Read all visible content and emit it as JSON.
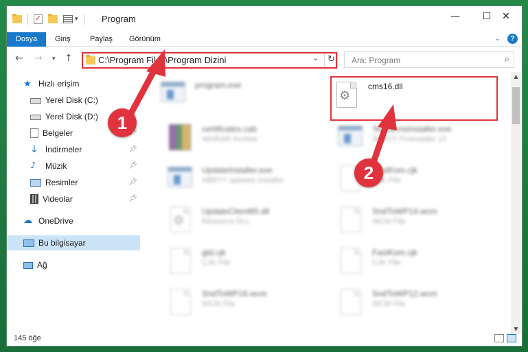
{
  "window": {
    "title": "Program",
    "controls": {
      "minimize": "—",
      "maximize": "☐",
      "close": "✕"
    }
  },
  "ribbon": {
    "tabs": [
      "Dosya",
      "Giriş",
      "Paylaş",
      "Görünüm"
    ],
    "active_tab": "Dosya"
  },
  "navigation": {
    "address": "C:\\Program Files\\Program Dizini",
    "search_placeholder": "Ara: Program"
  },
  "sidebar": {
    "items": [
      {
        "label": "Hızlı erişim",
        "icon": "star-icon"
      },
      {
        "label": "Yerel Disk (C:)",
        "icon": "drive-icon"
      },
      {
        "label": "Yerel Disk (D:)",
        "icon": "drive-icon"
      },
      {
        "label": "Belgeler",
        "icon": "documents-icon",
        "pinned": true
      },
      {
        "label": "İndirmeler",
        "icon": "download-icon",
        "pinned": true
      },
      {
        "label": "Müzik",
        "icon": "music-icon",
        "pinned": true
      },
      {
        "label": "Resimler",
        "icon": "pictures-icon",
        "pinned": true
      },
      {
        "label": "Videolar",
        "icon": "videos-icon",
        "pinned": true
      },
      {
        "label": "OneDrive",
        "icon": "cloud-icon"
      },
      {
        "label": "Bu bilgisayar",
        "icon": "computer-icon",
        "selected": true
      },
      {
        "label": "Ağ",
        "icon": "network-icon"
      }
    ]
  },
  "files": [
    {
      "name": "program.exe",
      "type": "",
      "kind": "exe"
    },
    {
      "name": "cms16.dll",
      "type": "",
      "kind": "dll",
      "highlighted": true
    },
    {
      "name": "certificates.cab",
      "type": "WinRAR Archive",
      "kind": "rar"
    },
    {
      "name": "TextItemsInstaller.exe",
      "type": "ABBYY Finereader 10",
      "kind": "exe"
    },
    {
      "name": "UpdateInstaller.exe",
      "type": "ABBYY updates installer",
      "kind": "exe"
    },
    {
      "name": "FastKom.cjk",
      "type": "CJK File",
      "kind": "doc"
    },
    {
      "name": "UpdateClient65.dll",
      "type": "Resource DLL",
      "kind": "dll"
    },
    {
      "name": "SndToWP14.wcm",
      "type": "WCM File",
      "kind": "doc"
    },
    {
      "name": "gtd.cjk",
      "type": "CJK File",
      "kind": "doc"
    },
    {
      "name": "FastKom.cjk",
      "type": "CJK File",
      "kind": "doc"
    },
    {
      "name": "SndToWP16.wcm",
      "type": "WCM File",
      "kind": "doc"
    },
    {
      "name": "SndToWP12.wcm",
      "type": "WCM File",
      "kind": "doc"
    }
  ],
  "callouts": [
    "1",
    "2"
  ],
  "status": {
    "count": "145 öğe"
  },
  "colors": {
    "accent": "#1979ca",
    "highlight": "#e0333d",
    "selection": "#cce4f7"
  }
}
